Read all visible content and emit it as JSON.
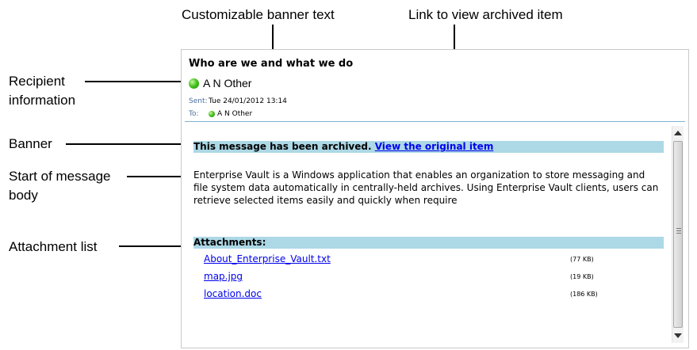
{
  "callouts": {
    "banner_text": "Customizable banner text",
    "archived_link": "Link to view archived item",
    "recipient_line1": "Recipient",
    "recipient_line2": "information",
    "banner": "Banner",
    "start_line1": "Start of message",
    "start_line2": "body",
    "attachment_list": "Attachment list"
  },
  "email": {
    "subject": "Who are we and what we do",
    "sender": "A N Other",
    "sent_key": "Sent:",
    "sent_value": "Tue 24/01/2012 13:14",
    "to_key": "To:",
    "to_value": "A N Other",
    "banner_text": "This message has been archived.",
    "banner_link": "View the original item",
    "body_text": "Enterprise Vault is a Windows application that enables an organization to store messaging and file system data automatically in centrally-held archives. Using Enterprise Vault clients, users can retrieve selected items easily and quickly when require",
    "attachments_heading": "Attachments:",
    "attachments": [
      {
        "name": "About_Enterprise_Vault.txt",
        "size": "(77 KB)"
      },
      {
        "name": "map.jpg",
        "size": "(19 KB)"
      },
      {
        "name": "location.doc",
        "size": "(186 KB)"
      }
    ]
  },
  "colors": {
    "band": "#add8e6",
    "link": "#0000ee",
    "presence": "#49c51e"
  }
}
